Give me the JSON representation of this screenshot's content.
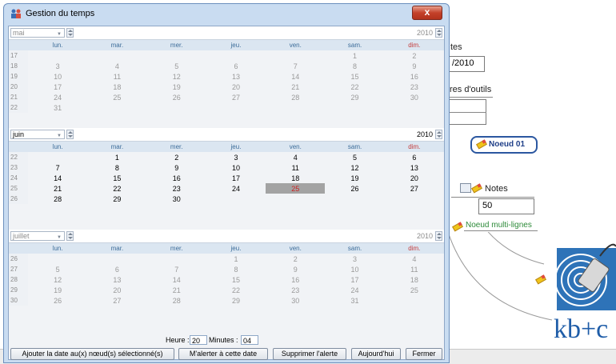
{
  "background_app": {
    "label_date": "tes",
    "date_value": "/2010",
    "label_tools": "res d'outils",
    "node_label": "Noeud 01",
    "notes_label": "Notes",
    "notes_value": "50",
    "multiline_label": "Noeud multi-lignes",
    "logo_text": "kb+c"
  },
  "dialog": {
    "title": "Gestion du temps",
    "close_symbol": "x",
    "weekdays": [
      "lun.",
      "mar.",
      "mer.",
      "jeu.",
      "ven.",
      "sam.",
      "dim."
    ],
    "months": [
      {
        "name": "mai",
        "year": "2010",
        "active": false,
        "weeks": [
          {
            "wk": "17",
            "days": [
              "",
              "",
              "",
              "",
              "",
              "1",
              "2"
            ]
          },
          {
            "wk": "18",
            "days": [
              "3",
              "4",
              "5",
              "6",
              "7",
              "8",
              "9"
            ]
          },
          {
            "wk": "19",
            "days": [
              "10",
              "11",
              "12",
              "13",
              "14",
              "15",
              "16"
            ]
          },
          {
            "wk": "20",
            "days": [
              "17",
              "18",
              "19",
              "20",
              "21",
              "22",
              "23"
            ]
          },
          {
            "wk": "21",
            "days": [
              "24",
              "25",
              "26",
              "27",
              "28",
              "29",
              "30"
            ]
          },
          {
            "wk": "22",
            "days": [
              "31",
              "",
              "",
              "",
              "",
              "",
              ""
            ]
          }
        ]
      },
      {
        "name": "juin",
        "year": "2010",
        "active": true,
        "weeks": [
          {
            "wk": "22",
            "days": [
              "",
              "1",
              "2",
              "3",
              "4",
              "5",
              "6"
            ]
          },
          {
            "wk": "23",
            "days": [
              "7",
              "8",
              "9",
              "10",
              "11",
              "12",
              "13"
            ]
          },
          {
            "wk": "24",
            "days": [
              "14",
              "15",
              "16",
              "17",
              "18",
              "19",
              "20"
            ]
          },
          {
            "wk": "25",
            "days": [
              "21",
              "22",
              "23",
              "24",
              "25",
              "26",
              "27"
            ]
          },
          {
            "wk": "26",
            "days": [
              "28",
              "29",
              "30",
              "",
              "",
              "",
              ""
            ]
          }
        ],
        "today": "25"
      },
      {
        "name": "juillet",
        "year": "2010",
        "active": false,
        "weeks": [
          {
            "wk": "26",
            "days": [
              "",
              "",
              "",
              "1",
              "2",
              "3",
              "4"
            ]
          },
          {
            "wk": "27",
            "days": [
              "5",
              "6",
              "7",
              "8",
              "9",
              "10",
              "11"
            ]
          },
          {
            "wk": "28",
            "days": [
              "12",
              "13",
              "14",
              "15",
              "16",
              "17",
              "18"
            ]
          },
          {
            "wk": "29",
            "days": [
              "19",
              "20",
              "21",
              "22",
              "23",
              "24",
              "25"
            ]
          },
          {
            "wk": "30",
            "days": [
              "26",
              "27",
              "28",
              "29",
              "30",
              "31",
              ""
            ]
          }
        ]
      }
    ],
    "time": {
      "hour_label": "Heure :",
      "hour_value": "20",
      "minutes_label": "Minutes :",
      "minutes_value": "04"
    },
    "buttons": {
      "add_date": "Ajouter la date au(x) nœud(s) sélectionné(s)",
      "alert_me": "M'alerter à cette date",
      "remove_alert": "Supprimer l'alerte",
      "today": "Aujourd'hui",
      "close": "Fermer"
    },
    "colors": {
      "today_bg": "#a3a3a3",
      "today_text": "#cc2222",
      "header_bg": "#dbe6f1",
      "weekday_text": "#3d6d9a"
    }
  }
}
